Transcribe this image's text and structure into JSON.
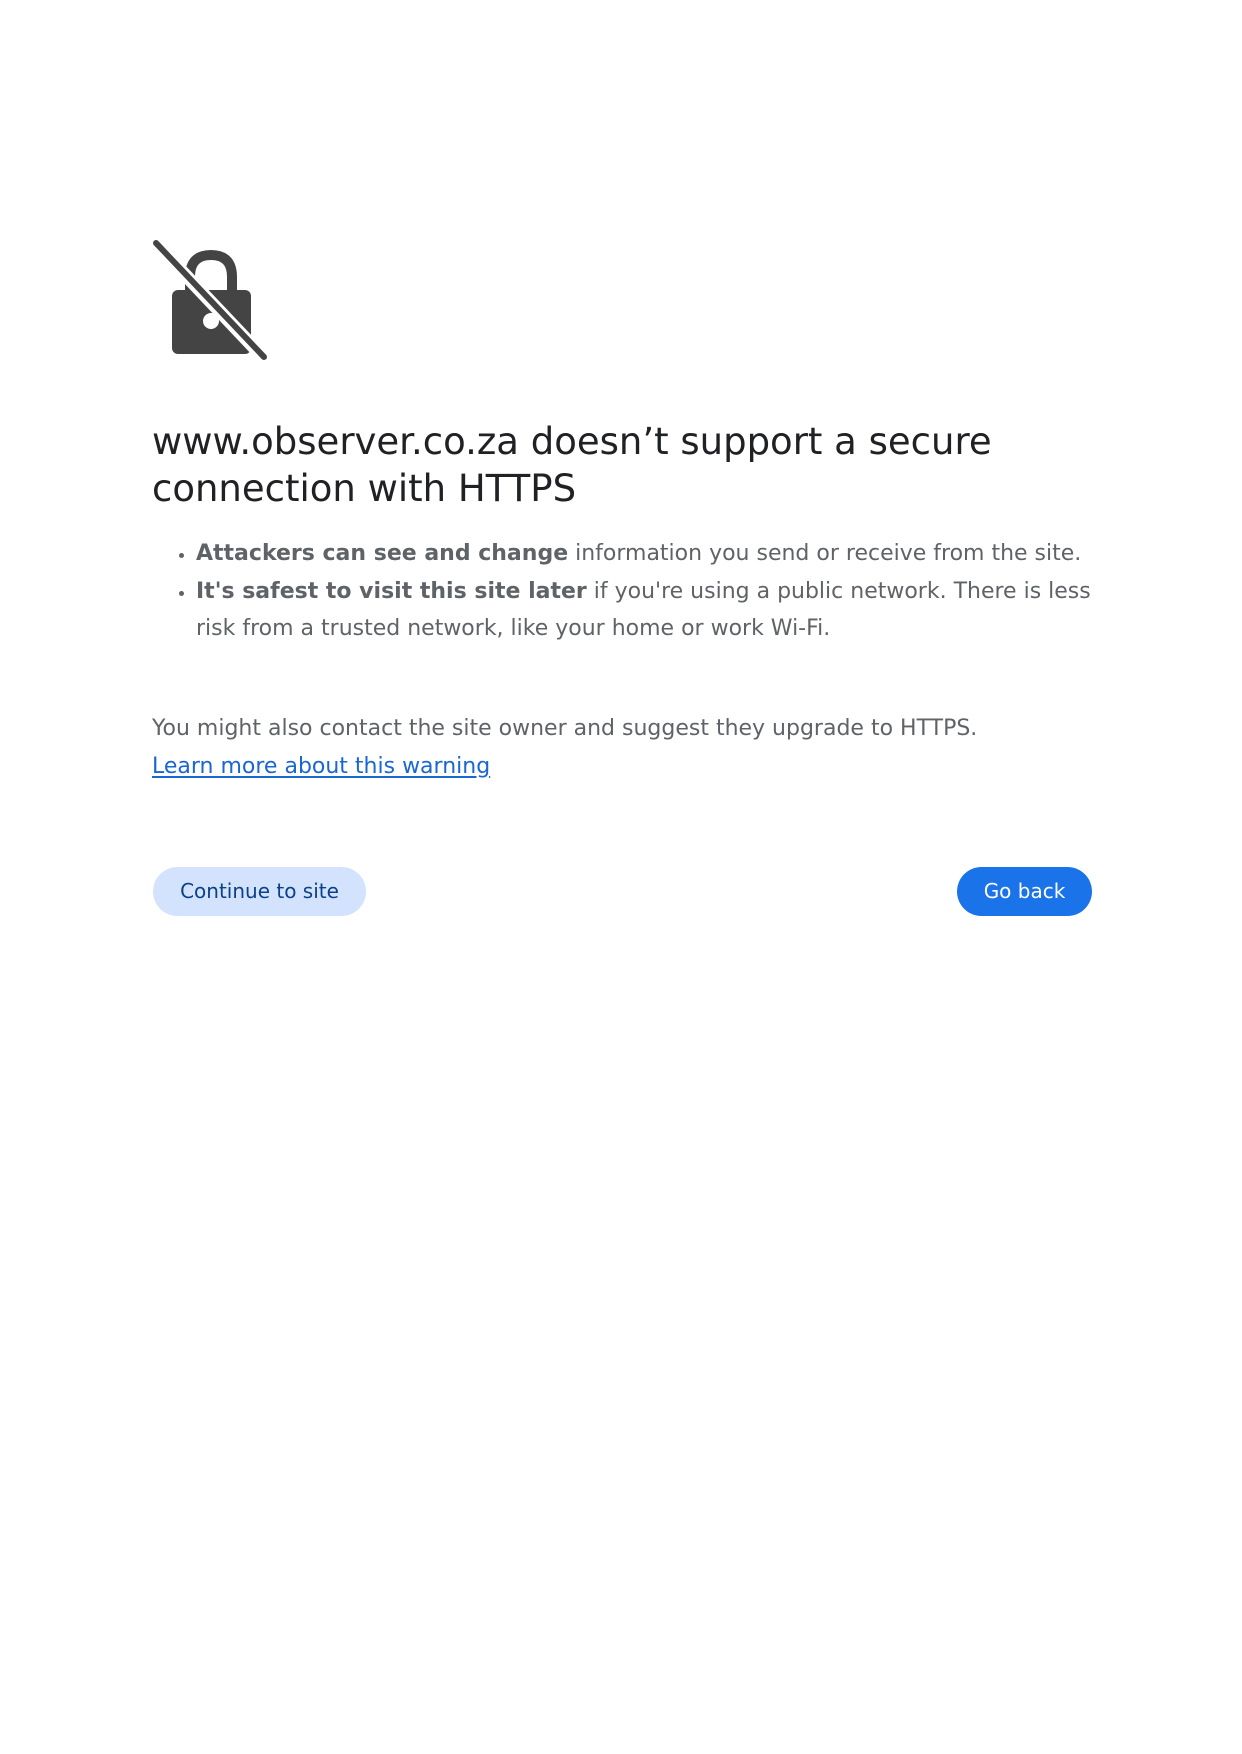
{
  "icon": "broken-lock-icon",
  "colors": {
    "icon": "#444444",
    "title": "#202124",
    "body_text": "#5f6368",
    "link": "#1a66d2",
    "secondary_button_bg": "#d3e3fd",
    "secondary_button_text": "#0b4189",
    "primary_button_bg": "#1a73e8",
    "primary_button_text": "#ffffff"
  },
  "title": "www.observer.co.za doesn’t support a secure connection with HTTPS",
  "bullets": [
    {
      "bold": "Attackers can see and change",
      "rest": " information you send or receive from the site."
    },
    {
      "bold": "It's safest to visit this site later",
      "rest": " if you're using a public network. There is less risk from a trusted network, like your home or work Wi-Fi."
    }
  ],
  "extra_text": "You might also contact the site owner and suggest they upgrade to HTTPS.",
  "learn_more_link": "Learn more about this warning",
  "buttons": {
    "continue": "Continue to site",
    "go_back": "Go back"
  }
}
